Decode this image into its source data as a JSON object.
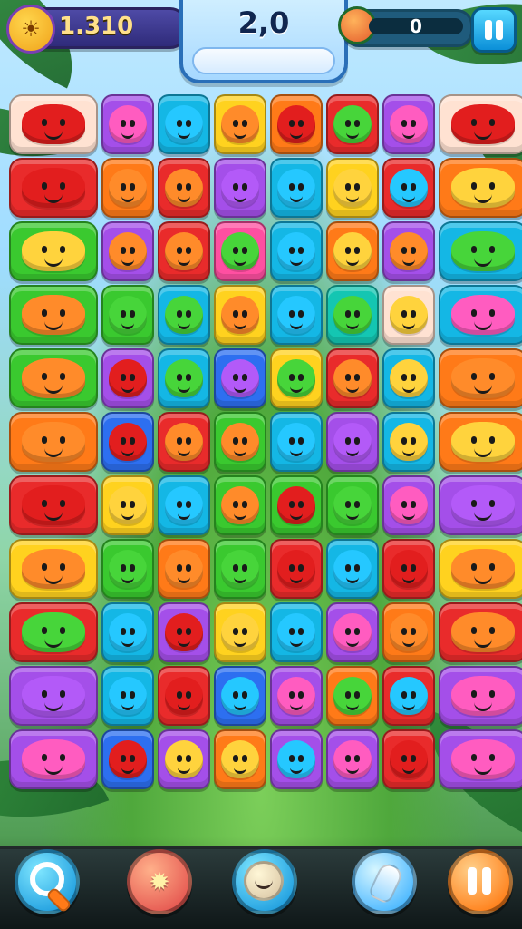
{
  "hud": {
    "left": {
      "value": "1.310"
    },
    "center": {
      "moves": "2,0"
    },
    "right": {
      "value": "0",
      "progress_fraction": 0.0
    }
  },
  "board": {
    "columns": 8,
    "rows": 11,
    "tiles": [
      [
        "cream-red",
        "purple-pink",
        "cyan-cyan",
        "yellow-orange",
        "orange-red",
        "red-green",
        "purple-pink",
        "cream-red"
      ],
      [
        "red-red",
        "orange-orange",
        "red-orange",
        "purple-purple",
        "cyan-cyan",
        "yellow-yellow",
        "red-cyan",
        "orange-yellow"
      ],
      [
        "green-yellow",
        "purple-orange",
        "red-orange",
        "pink-green",
        "cyan-cyan",
        "orange-yellow",
        "purple-orange",
        "cyan-green"
      ],
      [
        "green-orange",
        "green-green",
        "cyan-green",
        "yellow-orange",
        "cyan-cyan",
        "teal-green",
        "cream-yellow",
        "cyan-pink"
      ],
      [
        "green-orange",
        "purple-red",
        "cyan-green",
        "blue-purple",
        "yellow-green",
        "red-orange",
        "cyan-yellow",
        "orange-orange"
      ],
      [
        "orange-orange",
        "blue-red",
        "red-orange",
        "green-orange",
        "cyan-cyan",
        "purple-purple",
        "cyan-yellow",
        "orange-yellow"
      ],
      [
        "red-red",
        "yellow-yellow",
        "cyan-cyan",
        "green-orange",
        "green-red",
        "green-green",
        "purple-pink",
        "purple-purple"
      ],
      [
        "yellow-orange",
        "green-green",
        "orange-orange",
        "green-green",
        "red-red",
        "cyan-cyan",
        "red-red",
        "yellow-orange"
      ],
      [
        "red-green",
        "cyan-cyan",
        "purple-red",
        "yellow-yellow",
        "cyan-cyan",
        "purple-pink",
        "orange-orange",
        "red-orange"
      ],
      [
        "purple-purple",
        "cyan-cyan",
        "red-red",
        "blue-cyan",
        "purple-pink",
        "orange-green",
        "red-cyan",
        "purple-pink"
      ],
      [
        "purple-pink",
        "blue-red",
        "purple-yellow",
        "orange-yellow",
        "purple-cyan",
        "purple-pink",
        "red-red",
        "purple-pink"
      ]
    ]
  }
}
